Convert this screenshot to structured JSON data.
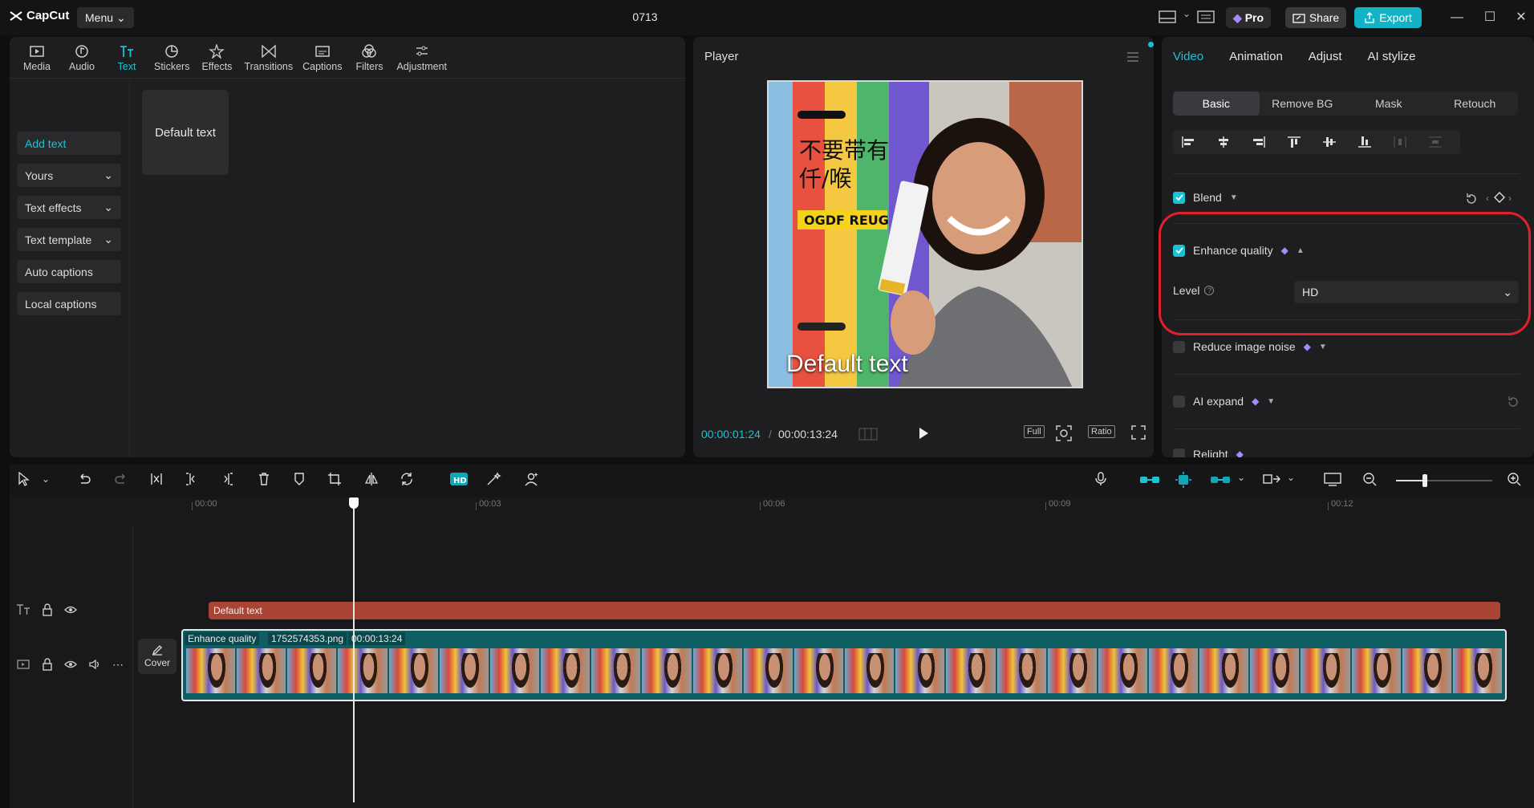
{
  "app": {
    "name": "CapCut",
    "menu_label": "Menu",
    "project_title": "0713"
  },
  "header": {
    "pro_label": "Pro",
    "share_label": "Share",
    "export_label": "Export"
  },
  "media_tabs": [
    {
      "label": "Media",
      "icon": "media-icon"
    },
    {
      "label": "Audio",
      "icon": "audio-icon"
    },
    {
      "label": "Text",
      "icon": "text-icon",
      "active": true
    },
    {
      "label": "Stickers",
      "icon": "stickers-icon"
    },
    {
      "label": "Effects",
      "icon": "effects-icon"
    },
    {
      "label": "Transitions",
      "icon": "transitions-icon"
    },
    {
      "label": "Captions",
      "icon": "captions-icon"
    },
    {
      "label": "Filters",
      "icon": "filters-icon"
    },
    {
      "label": "Adjustment",
      "icon": "adjustment-icon"
    }
  ],
  "text_sidebar": {
    "items": [
      {
        "label": "Add text",
        "active": true
      },
      {
        "label": "Yours",
        "dropdown": true
      },
      {
        "label": "Text effects",
        "dropdown": true
      },
      {
        "label": "Text template",
        "dropdown": true
      },
      {
        "label": "Auto captions"
      },
      {
        "label": "Local captions"
      }
    ],
    "default_card": "Default text"
  },
  "player": {
    "title": "Player",
    "overlay_text": "Default text",
    "current_time": "00:00:01:24",
    "total_time": "00:00:13:24",
    "full_label": "Full",
    "ratio_label": "Ratio"
  },
  "inspector": {
    "tabs": [
      "Video",
      "Animation",
      "Adjust",
      "AI stylize"
    ],
    "active_tab": "Video",
    "subtabs": [
      "Basic",
      "Remove BG",
      "Mask",
      "Retouch"
    ],
    "active_subtab": "Basic",
    "blend_label": "Blend",
    "enhance_label": "Enhance quality",
    "level_label": "Level",
    "level_value": "HD",
    "noise_label": "Reduce image noise",
    "expand_label": "AI expand",
    "relight_label": "Relight",
    "accent": "#19c3d6",
    "highlight_color": "#e0202a"
  },
  "timeline": {
    "ruler": [
      "00:00",
      "00:03",
      "00:06",
      "00:09",
      "00:12"
    ],
    "text_clip_label": "Default text",
    "video_clip": {
      "name": "Enhance quality",
      "file": "1752574353.png",
      "duration": "00:00:13:24"
    },
    "cover_label": "Cover",
    "zoom_level": 0.3
  }
}
